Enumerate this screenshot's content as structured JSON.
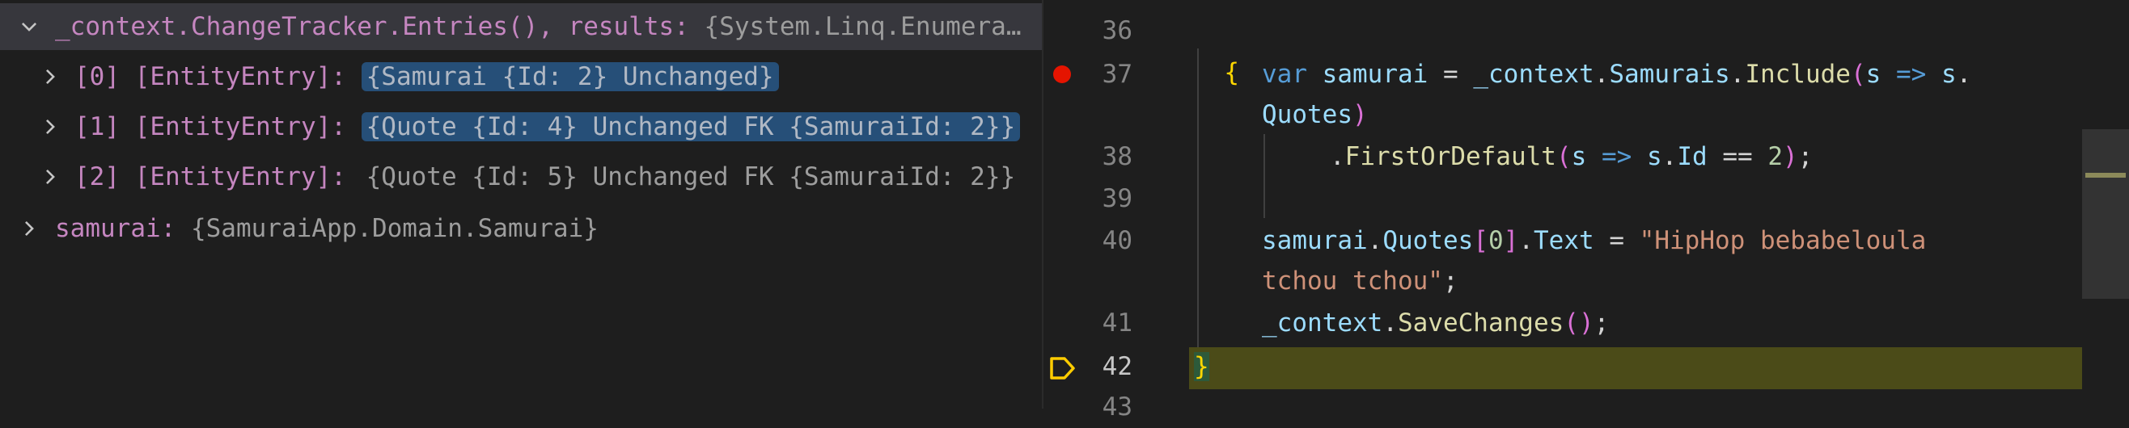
{
  "variables": {
    "root": {
      "name": "_context.ChangeTracker.Entries(), results:",
      "value": "{System.Linq.Enumera…"
    },
    "entries": [
      {
        "index": "[0]",
        "type": "[EntityEntry]:",
        "value": "{Samurai {Id: 2} Unchanged}",
        "highlighted": true
      },
      {
        "index": "[1]",
        "type": "[EntityEntry]:",
        "value": "{Quote {Id: 4} Unchanged FK {SamuraiId: 2}}",
        "highlighted": true
      },
      {
        "index": "[2]",
        "type": "[EntityEntry]:",
        "value": "{Quote {Id: 5} Unchanged FK {SamuraiId: 2}}",
        "highlighted": false
      }
    ],
    "samurai": {
      "name": "samurai:",
      "value": "{SamuraiApp.Domain.Samurai}"
    }
  },
  "editor": {
    "line_numbers": [
      "36",
      "37",
      "38",
      "39",
      "40",
      "41",
      "42",
      "43"
    ],
    "breakpoint_line": "37",
    "current_line": "42",
    "code": {
      "l36_brace": "{",
      "l37": [
        "var",
        "samurai",
        "=",
        "_context",
        ".",
        "Samurais",
        ".",
        "Include",
        "(",
        "s",
        "=>",
        "s",
        "."
      ],
      "l37_wrap": [
        "Quotes",
        ")"
      ],
      "l38": [
        ".",
        "FirstOrDefault",
        "(",
        "s",
        "=>",
        "s",
        ".",
        "Id",
        "==",
        "2",
        ")",
        ";"
      ],
      "l40": [
        "samurai",
        ".",
        "Quotes",
        "[",
        "0",
        "]",
        ".",
        "Text",
        "=",
        "\"HipHop bebabeloula"
      ],
      "l40_wrap": [
        "tchou tchou\"",
        ";"
      ],
      "l41": [
        "_context",
        ".",
        "SaveChanges",
        "()",
        ";"
      ],
      "l42_brace": "}"
    }
  },
  "colors": {
    "background": "#1e1e1e",
    "selected_row": "#37373d",
    "value_highlight": "#264f78",
    "current_line": "#4b4b18",
    "breakpoint": "#e51400",
    "exec_arrow": "#ffcc00"
  }
}
